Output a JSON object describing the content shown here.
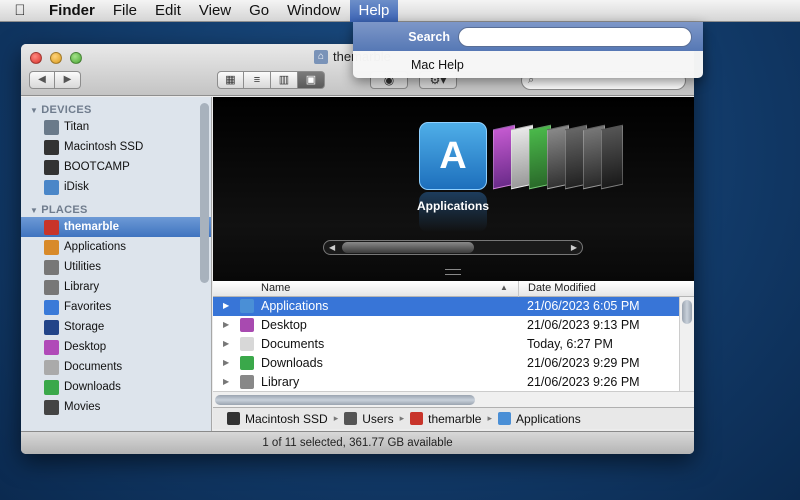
{
  "menubar": {
    "apple": "",
    "items": [
      "Finder",
      "File",
      "Edit",
      "View",
      "Go",
      "Window",
      "Help"
    ]
  },
  "help_menu": {
    "search_label": "Search",
    "search_value": "",
    "item": "Mac Help"
  },
  "window": {
    "title": "themarble",
    "nav_back": "◀",
    "nav_forward": "▶",
    "view_modes": [
      "icon",
      "list",
      "column",
      "cover-flow"
    ],
    "active_view": "cover-flow"
  },
  "sidebar": {
    "devices_header": "DEVICES",
    "devices": [
      {
        "label": "Titan",
        "icon": "laptop-icon",
        "color": "#6a7a8a"
      },
      {
        "label": "Macintosh SSD",
        "icon": "drive-icon",
        "color": "#333333"
      },
      {
        "label": "BOOTCAMP",
        "icon": "drive-icon",
        "color": "#333333"
      },
      {
        "label": "iDisk",
        "icon": "idisk-icon",
        "color": "#4a86c8"
      }
    ],
    "places_header": "PLACES",
    "places": [
      {
        "label": "themarble",
        "icon": "home-icon",
        "color": "#c8342a",
        "selected": true
      },
      {
        "label": "Applications",
        "icon": "applications-icon",
        "color": "#d88a2a"
      },
      {
        "label": "Utilities",
        "icon": "utilities-icon",
        "color": "#777777"
      },
      {
        "label": "Library",
        "icon": "library-icon",
        "color": "#777777"
      },
      {
        "label": "Favorites",
        "icon": "favorites-icon",
        "color": "#3a7ad8"
      },
      {
        "label": "Storage",
        "icon": "storage-icon",
        "color": "#224488"
      },
      {
        "label": "Desktop",
        "icon": "desktop-icon",
        "color": "#b04ab8"
      },
      {
        "label": "Documents",
        "icon": "documents-icon",
        "color": "#aaaaaa"
      },
      {
        "label": "Downloads",
        "icon": "downloads-icon",
        "color": "#3aa84a"
      },
      {
        "label": "Movies",
        "icon": "movies-icon",
        "color": "#444444"
      }
    ]
  },
  "coverflow": {
    "selected_label": "Applications"
  },
  "list": {
    "col_name": "Name",
    "col_date": "Date Modified",
    "rows": [
      {
        "name": "Applications",
        "date": "21/06/2023 6:05 PM",
        "icon": "applications-folder-icon",
        "color": "#4a8fd6",
        "selected": true
      },
      {
        "name": "Desktop",
        "date": "21/06/2023 9:13 PM",
        "icon": "desktop-folder-icon",
        "color": "#a84ab0",
        "selected": false
      },
      {
        "name": "Documents",
        "date": "Today, 6:27 PM",
        "icon": "documents-folder-icon",
        "color": "#d8d8d8",
        "selected": false
      },
      {
        "name": "Downloads",
        "date": "21/06/2023 9:29 PM",
        "icon": "downloads-folder-icon",
        "color": "#3aa84a",
        "selected": false
      },
      {
        "name": "Library",
        "date": "21/06/2023 9:26 PM",
        "icon": "library-folder-icon",
        "color": "#888888",
        "selected": false
      }
    ]
  },
  "pathbar": {
    "segments": [
      {
        "label": "Macintosh SSD",
        "icon": "drive-icon",
        "color": "#333333"
      },
      {
        "label": "Users",
        "icon": "users-folder-icon",
        "color": "#555555"
      },
      {
        "label": "themarble",
        "icon": "home-icon",
        "color": "#c8342a"
      },
      {
        "label": "Applications",
        "icon": "applications-icon",
        "color": "#4a8fd6"
      }
    ]
  },
  "status": "1 of 11 selected, 361.77 GB available",
  "colors": {
    "selection": "#3875d7",
    "sidebar_bg": "#dde4ec",
    "desktop": "#123b6a"
  }
}
